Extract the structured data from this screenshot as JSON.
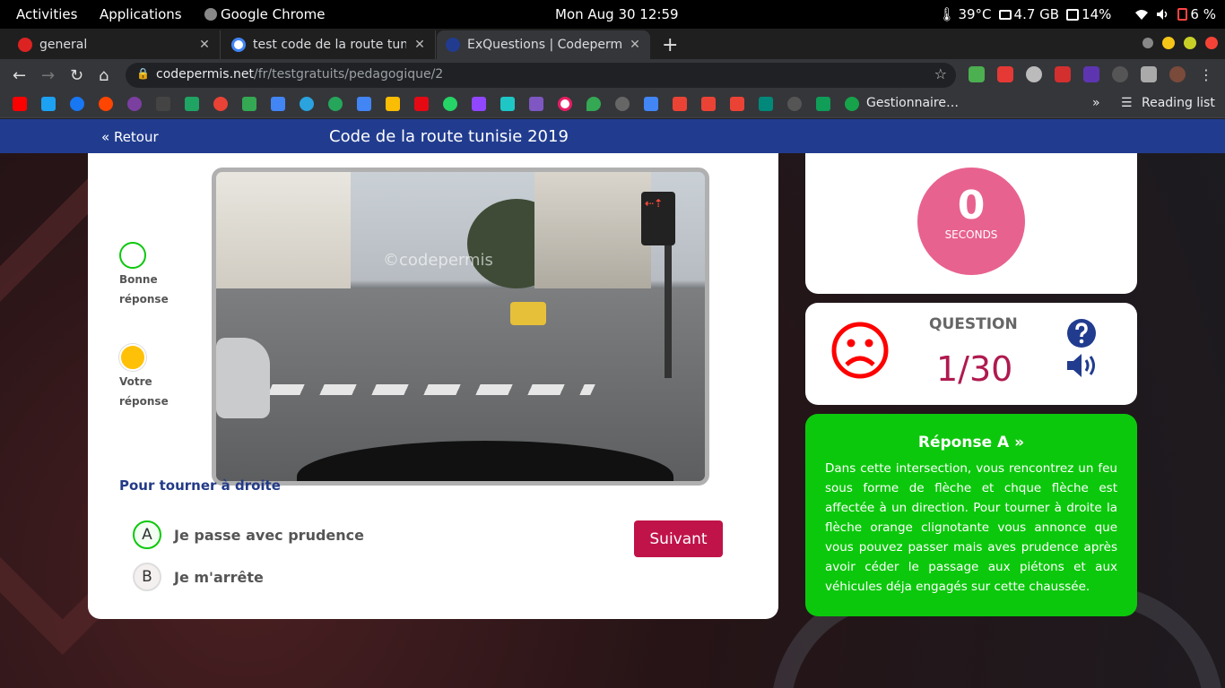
{
  "system_bar": {
    "activities": "Activities",
    "applications": "Applications",
    "app_name": "Google Chrome",
    "clock": "Mon Aug 30  12:59",
    "temperature": "39°C",
    "memory": "4.7 GB",
    "disk": "14%",
    "battery": "6 %"
  },
  "tabs": [
    {
      "title": "general"
    },
    {
      "title": "test code de la route tunisie"
    },
    {
      "title": "ExQuestions | Codepermis"
    }
  ],
  "address": {
    "host": "codepermis.net",
    "path": "/fr/testgratuits/pedagogique/2"
  },
  "bookmarks": {
    "gestionnaire": "Gestionnaire…",
    "reading_list": "Reading list"
  },
  "site": {
    "back": "« Retour",
    "title": "Code de la route tunisie 2019"
  },
  "legend": {
    "good": "Bonne réponse",
    "yours": "Votre réponse"
  },
  "photo": {
    "watermark": "©codepermis"
  },
  "question": {
    "text": "Pour tourner à droite",
    "answers": [
      {
        "letter": "A",
        "text": "Je passe avec prudence"
      },
      {
        "letter": "B",
        "text": "Je m'arrête"
      }
    ],
    "next_button": "Suivant"
  },
  "timer": {
    "value": "0",
    "label": "SECONDS"
  },
  "progress": {
    "label": "QUESTION",
    "count": "1/30"
  },
  "explanation": {
    "heading": "Réponse A »",
    "text": "Dans cette intersection, vous rencontrez un feu sous forme de flèche et chque flèche est affectée à un direction. Pour tourner à droite la flèche orange clignotante vous annonce que vous pouvez passer mais aves prudence après avoir céder le passage aux piétons et aux véhicules déja engagés sur cette chaussée."
  },
  "colors": {
    "header_blue": "#213c8f",
    "timer_pink": "#e8628f",
    "count_red": "#b0194f",
    "correct_green": "#0cc80c",
    "your_answer_yellow": "#ffc107",
    "next_button": "#c0134a"
  }
}
